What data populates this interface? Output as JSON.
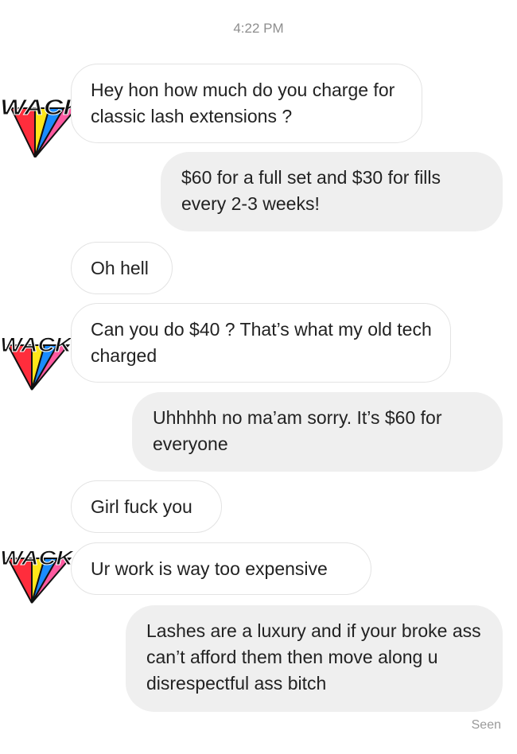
{
  "thread": {
    "timestamp": "4:22 PM",
    "status": "Seen"
  },
  "avatar": {
    "logo_text": "WACK",
    "icon": "wack-logo-icon",
    "colors": {
      "red": "#ff2d3c",
      "pink": "#ff5aa0",
      "yellow": "#ffe61a",
      "blue": "#1a8cff",
      "outline": "#111111"
    }
  },
  "colors": {
    "incoming_bubble_bg": "#ffffff",
    "incoming_bubble_border": "#e3e3e3",
    "outgoing_bubble_bg": "#efefef",
    "text": "#222222",
    "meta_text": "#8e8e8e"
  },
  "messages": [
    {
      "sender": "them",
      "text": "Hey hon how much do you charge for classic lash extensions ?"
    },
    {
      "sender": "me",
      "text": "$60 for a full set and $30 for fills every 2-3 weeks!"
    },
    {
      "sender": "them",
      "text": "Oh hell"
    },
    {
      "sender": "them",
      "text": "Can you do $40 ? That’s what my old tech charged"
    },
    {
      "sender": "me",
      "text": "Uhhhhh no ma’am sorry. It’s $60 for everyone"
    },
    {
      "sender": "them",
      "text": "Girl fuck you"
    },
    {
      "sender": "them",
      "text": "Ur work is way too expensive"
    },
    {
      "sender": "me",
      "text": "Lashes are a luxury and if your broke ass can’t afford them then move along u disrespectful ass bitch"
    }
  ]
}
